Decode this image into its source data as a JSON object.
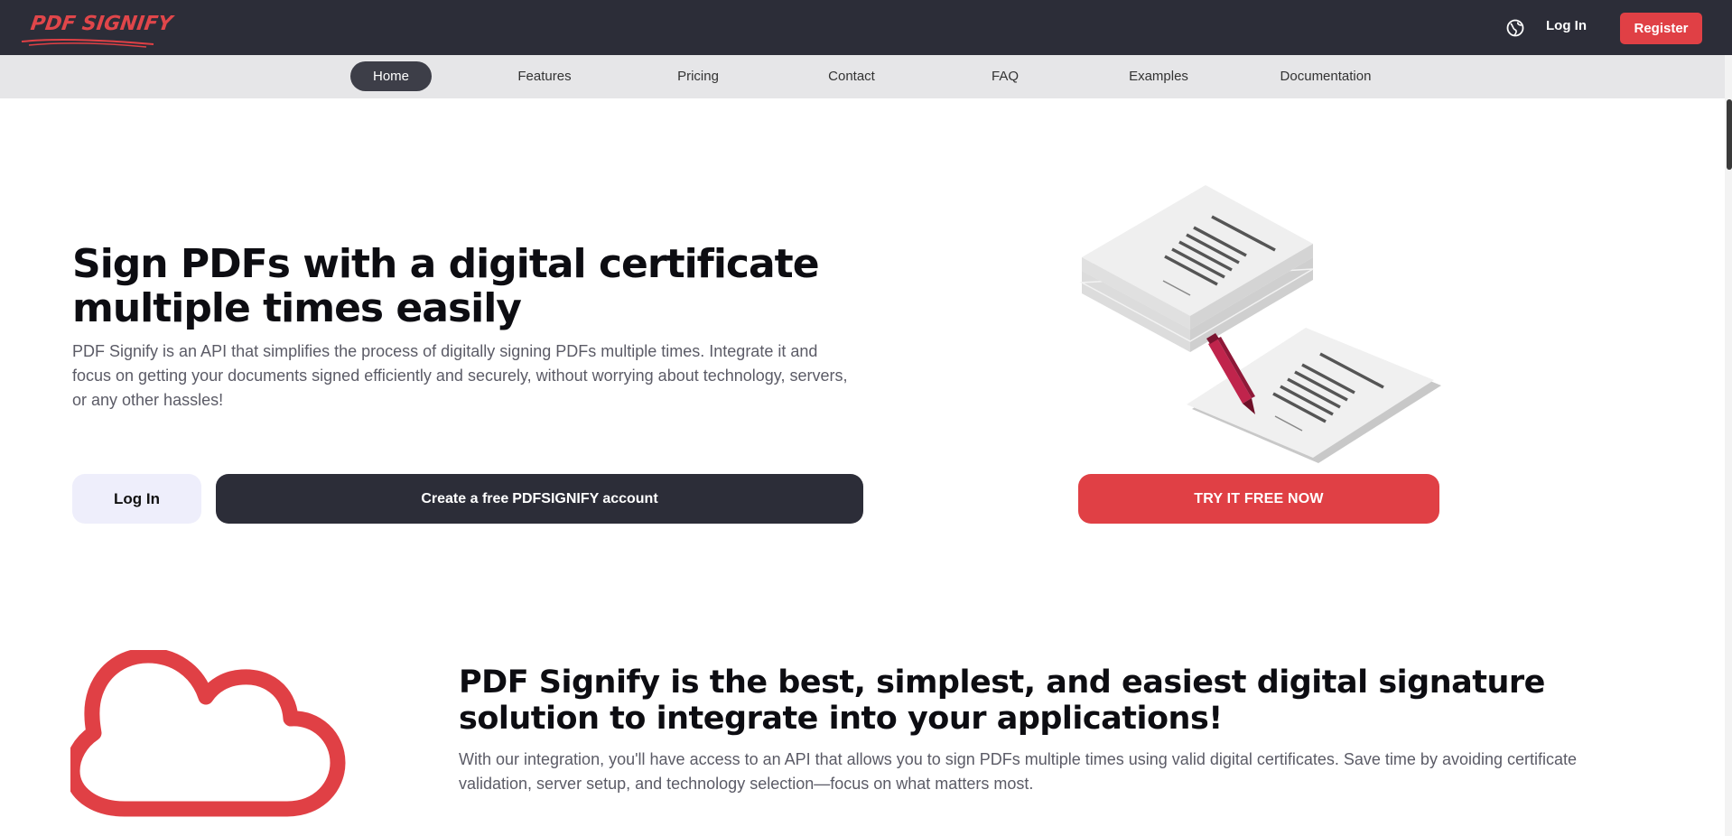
{
  "brand": {
    "logo_text": "PDF SIGNIFY",
    "accent_color": "#e04045",
    "dark_color": "#2c2d38"
  },
  "topbar": {
    "language_icon": "globe-icon",
    "login_label": "Log In",
    "register_label": "Register"
  },
  "nav": {
    "items": [
      {
        "label": "Home",
        "active": true
      },
      {
        "label": "Features"
      },
      {
        "label": "Pricing"
      },
      {
        "label": "Contact"
      },
      {
        "label": "FAQ"
      },
      {
        "label": "Examples"
      },
      {
        "label": "Documentation"
      }
    ]
  },
  "hero": {
    "title": "Sign PDFs with a digital certificate multiple times easily",
    "description": "PDF Signify is an API that simplifies the process of digitally signing PDFs multiple times. Integrate it and focus on getting your documents signed efficiently and securely, without worrying about technology, servers, or any other hassles!",
    "login_label": "Log In",
    "create_prefix": "Create a free",
    "create_brand": "PDFSIGNIFY",
    "create_suffix": "account",
    "try_label": "TRY IT FREE NOW",
    "illustration_icon": "documents-signing-icon"
  },
  "section": {
    "icon": "cloud-icon",
    "title": "PDF Signify is the best, simplest, and easiest digital signature solution to integrate into your applications!",
    "description": "With our integration, you'll have access to an API that allows you to sign PDFs multiple times using valid digital certificates. Save time by avoiding certificate validation, server setup, and technology selection—focus on what matters most."
  }
}
